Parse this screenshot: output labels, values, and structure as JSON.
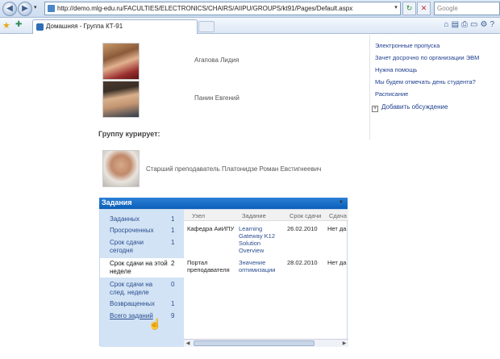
{
  "browser": {
    "url": "http://demo.mlg-edu.ru/FACULTIES/ELECTRONICS/CHAIRS/AIIPU/GROUPS/kt91/Pages/Default.aspx",
    "search_placeholder": "Google",
    "tab_title": "Домашняя - Группа КТ-91",
    "back_icon": "back-arrow-icon",
    "forward_icon": "forward-arrow-icon"
  },
  "students": [
    {
      "name": "Агапова Лидия"
    },
    {
      "name": "Панин Евгений"
    }
  ],
  "curator": {
    "heading": "Группу курирует:",
    "name": "Старший преподаватель Платонидзе Роман Евстигнеевич"
  },
  "right_links": {
    "items": [
      "Электронные пропуска",
      "Зачет досрочно по организации ЭВМ",
      "Нужна помощь",
      "Мы будем отмечать день студента?",
      "Расписание"
    ],
    "add_discussion": "Добавить обсуждение"
  },
  "tasks": {
    "title": "Задания",
    "filters": [
      {
        "label": "Заданных",
        "count": "1"
      },
      {
        "label": "Просроченных",
        "count": "1"
      },
      {
        "label": "Срок сдачи сегодня",
        "count": "1"
      },
      {
        "label": "Срок сдачи на этой неделе",
        "count": "2"
      },
      {
        "label": "Срок сдачи на след. неделе",
        "count": "0"
      },
      {
        "label": "Возвращенных",
        "count": "1"
      },
      {
        "label": "Всего заданий",
        "count": "9"
      }
    ],
    "columns": [
      "Узел",
      "Задание",
      "Срок сдачи",
      "Сдача"
    ],
    "rows": [
      {
        "node": "Кафедра АиИПУ",
        "task": "Learning Gateway K12 Solution Overview",
        "due": "26.02.2010",
        "status": "Нет да"
      },
      {
        "node": "Портал преподавателя",
        "task": "Значение оптимизации",
        "due": "28.02.2010",
        "status": "Нет да"
      }
    ]
  }
}
